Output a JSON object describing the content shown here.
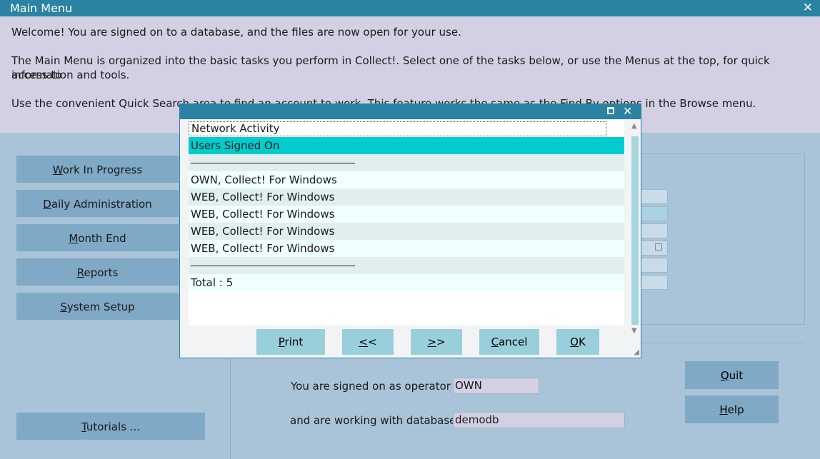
{
  "window": {
    "title": "Main Menu",
    "close_glyph": "✕"
  },
  "welcome": {
    "line1": "Welcome! You are signed on to a database, and the files are now open for your use.",
    "line2a": "The Main Menu is organized into the basic tasks you perform in Collect!. Select one of the tasks below, or use the Menus at the top, for quick access to",
    "line2b": "information and tools.",
    "line3": "Use the convenient Quick Search area to find an account to work. This feature works the same as the Find By options in the Browse menu."
  },
  "nav": {
    "work_in_progress": {
      "mn": "W",
      "rest": "ork In Progress"
    },
    "daily_administration": {
      "mn": "D",
      "rest": "aily Administration"
    },
    "month_end": {
      "mn": "M",
      "rest": "onth End"
    },
    "reports": {
      "mn": "R",
      "rest": "eports"
    },
    "system_setup": {
      "mn": "S",
      "rest": "ystem Setup"
    },
    "tutorials": {
      "mn": "T",
      "rest": "utorials ..."
    }
  },
  "status": {
    "operator_label": "You are signed on as operator",
    "operator_value": "OWN",
    "database_label": "and are working with database",
    "database_value": "demodb"
  },
  "side_buttons": {
    "quit": {
      "mn": "Q",
      "rest": "uit"
    },
    "help": {
      "mn": "H",
      "rest": "elp"
    }
  },
  "dialog": {
    "header": "Network Activity",
    "selected": "Users Signed On",
    "users": [
      "OWN, Collect! For Windows",
      "WEB, Collect! For Windows",
      "WEB, Collect! For Windows",
      "WEB, Collect! For Windows",
      "WEB, Collect! For Windows"
    ],
    "total": "Total : 5",
    "close_glyph": "✕",
    "buttons": {
      "print": {
        "mn": "P",
        "rest": "rint"
      },
      "prev": {
        "mn": "<",
        "rest": "<"
      },
      "next": {
        "mn": ">",
        "rest": ">"
      },
      "cancel": {
        "mn": "C",
        "rest": "ancel"
      },
      "ok": {
        "mn": "O",
        "rest": "K"
      }
    }
  },
  "colors": {
    "titlebar": "#2a83a3",
    "selection": "#00cccc",
    "button": "#7fa9c5",
    "dialog_button": "#99cfdb"
  }
}
